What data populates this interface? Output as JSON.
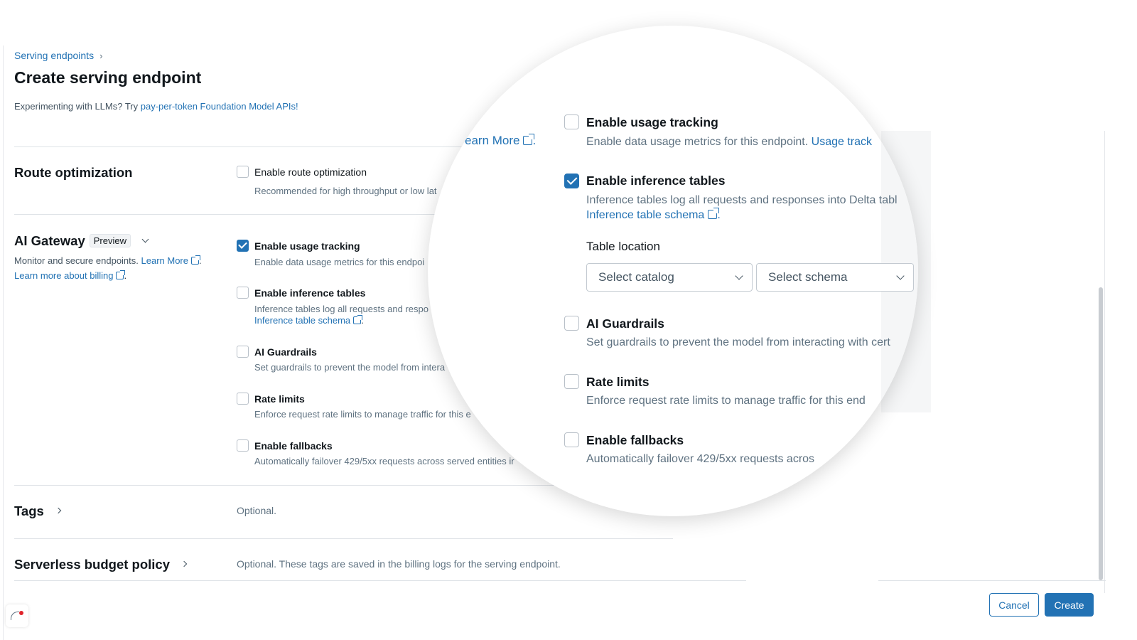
{
  "breadcrumb": {
    "label": "Serving endpoints",
    "separator": "›"
  },
  "page_title": "Create serving endpoint",
  "notice": {
    "text": "Experimenting with LLMs? Try ",
    "link": "pay-per-token Foundation Model APIs!"
  },
  "route_optimization": {
    "heading": "Route optimization",
    "option_label": "Enable route optimization",
    "option_desc": "Recommended for high throughput or low lat",
    "checked": false
  },
  "ai_gateway": {
    "heading": "AI Gateway",
    "badge": "Preview",
    "description": "Monitor and secure endpoints.",
    "learn_more": "Learn More",
    "billing_link": "Learn more about billing",
    "options": [
      {
        "label": "Enable usage tracking",
        "desc": "Enable data usage metrics for this endpoi",
        "checked": true
      },
      {
        "label": "Enable inference tables",
        "desc": "Inference tables log all requests and respo",
        "link": "Inference table schema",
        "checked": false
      },
      {
        "label": "AI Guardrails",
        "desc": "Set guardrails to prevent the model from intera",
        "checked": false
      },
      {
        "label": "Rate limits",
        "desc": "Enforce request rate limits to manage traffic for this e",
        "checked": false
      },
      {
        "label": "Enable fallbacks",
        "desc": "Automatically failover 429/5xx requests across served entities ir",
        "checked": false
      }
    ]
  },
  "tags": {
    "heading": "Tags",
    "hint": "Optional."
  },
  "budget": {
    "heading": "Serverless budget policy",
    "hint": "Optional. These tags are saved in the billing logs for the serving endpoint."
  },
  "footer": {
    "cancel": "Cancel",
    "create": "Create"
  },
  "magnifier": {
    "learn_more_fragment": "earn More",
    "usage": {
      "label": "Enable usage tracking",
      "desc": "Enable data usage metrics for this endpoint.",
      "link": "Usage track",
      "checked": false
    },
    "inference": {
      "label": "Enable inference tables",
      "desc": "Inference tables log all requests and responses into Delta tabl",
      "link": "Inference table schema",
      "checked": true
    },
    "table_location": "Table location",
    "select_catalog": "Select catalog",
    "select_schema": "Select schema",
    "guardrails": {
      "label": "AI Guardrails",
      "desc": "Set guardrails to prevent the model from interacting with cert",
      "checked": false
    },
    "rate_limits": {
      "label": "Rate limits",
      "desc": "Enforce request rate limits to manage traffic for this end",
      "checked": false
    },
    "fallbacks": {
      "label": "Enable fallbacks",
      "desc": "Automatically failover 429/5xx requests acros",
      "checked": false
    }
  },
  "colors": {
    "accent": "#2272b4",
    "text": "#11171c",
    "muted": "#5f7281",
    "divider": "#dfe3e7"
  },
  "icons": [
    "chevron-right-icon",
    "chevron-down-icon",
    "external-link-icon",
    "checkbox-icon",
    "assistant-icon"
  ]
}
